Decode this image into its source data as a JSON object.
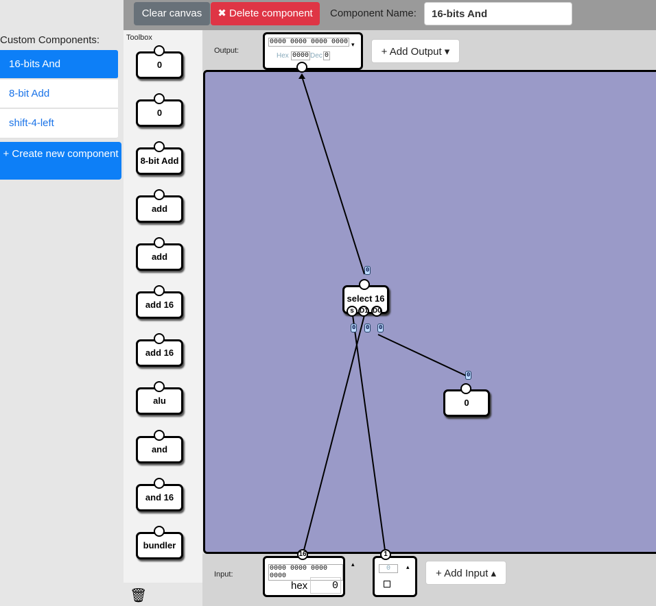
{
  "custom_components": {
    "title": "Custom Components:",
    "items": [
      "16-bits And",
      "8-bit Add",
      "shift-4-left"
    ],
    "create_label": "+ Create new component"
  },
  "topbar": {
    "clear_label": "Clear canvas",
    "delete_label": "✖ Delete component",
    "name_label": "Component Name:",
    "name_value": "16-bits And"
  },
  "toolbox": {
    "label": "Toolbox",
    "tools": [
      {
        "label": "0"
      },
      {
        "label": "0"
      },
      {
        "label": "8-bit Add"
      },
      {
        "label": "add"
      },
      {
        "label": "add"
      },
      {
        "label": "add 16"
      },
      {
        "label": "add 16"
      },
      {
        "label": "alu"
      },
      {
        "label": "and"
      },
      {
        "label": "and 16"
      },
      {
        "label": "bundler"
      }
    ]
  },
  "output": {
    "label": "Output:",
    "bits": "0000 0000 0000 0000",
    "hex_label": "Hex",
    "hex_value": "0000",
    "dec_label": "Dec",
    "dec_value": "0",
    "add_label": "+ Add Output ▾"
  },
  "input": {
    "label": "Input:",
    "bits": "0000 0000 0000 0000",
    "hex_label": "hex",
    "hex_value": "0",
    "bit1_value": "0",
    "add_label": "+ Add Input ▴",
    "pin_width_16": "16",
    "pin_width_1": "1"
  },
  "nodes": {
    "select": {
      "label": "select 16",
      "pins": [
        "s",
        "D1",
        "D0"
      ]
    },
    "const": {
      "label": "0"
    }
  },
  "values": {
    "select_out": "0",
    "s": "0",
    "d1": "0",
    "d0": "0",
    "const_out": "0"
  }
}
